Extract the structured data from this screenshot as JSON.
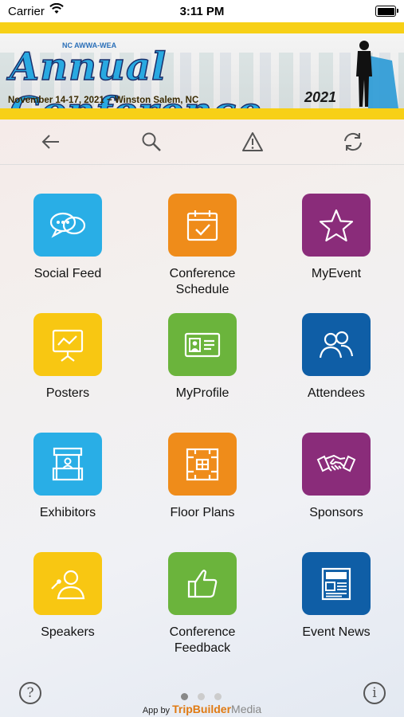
{
  "status_bar": {
    "carrier": "Carrier",
    "time": "3:11 PM"
  },
  "banner": {
    "org": "NC AWWA-WEA",
    "title": "Annual Conference",
    "year": "2021",
    "dates": "November 14-17, 2021  ~  Winston Salem, NC"
  },
  "toolbar": {
    "icons": [
      "back-arrow-icon",
      "search-icon",
      "warning-icon",
      "refresh-icon"
    ]
  },
  "tiles": [
    {
      "label": "Social Feed",
      "icon": "chat-bubbles-icon",
      "color": "#29aee6"
    },
    {
      "label": "Conference\nSchedule",
      "icon": "calendar-icon",
      "color": "#ef8c1a"
    },
    {
      "label": "MyEvent",
      "icon": "star-icon",
      "color": "#8a2c7a"
    },
    {
      "label": "Posters",
      "icon": "presentation-board-icon",
      "color": "#f8c712"
    },
    {
      "label": "MyProfile",
      "icon": "id-card-icon",
      "color": "#6bb43c"
    },
    {
      "label": "Attendees",
      "icon": "people-icon",
      "color": "#0f5ea6"
    },
    {
      "label": "Exhibitors",
      "icon": "booth-icon",
      "color": "#29aee6"
    },
    {
      "label": "Floor Plans",
      "icon": "floor-plan-icon",
      "color": "#ef8c1a"
    },
    {
      "label": "Sponsors",
      "icon": "handshake-icon",
      "color": "#8a2c7a"
    },
    {
      "label": "Speakers",
      "icon": "speaker-icon",
      "color": "#f8c712"
    },
    {
      "label": "Conference\nFeedback",
      "icon": "thumbs-up-icon",
      "color": "#6bb43c"
    },
    {
      "label": "Event News",
      "icon": "newspaper-icon",
      "color": "#0f5ea6"
    }
  ],
  "footer": {
    "help": "?",
    "info": "i",
    "credit_prefix": "App by",
    "credit_brand": "TripBuilder",
    "credit_brand2": "Media"
  }
}
